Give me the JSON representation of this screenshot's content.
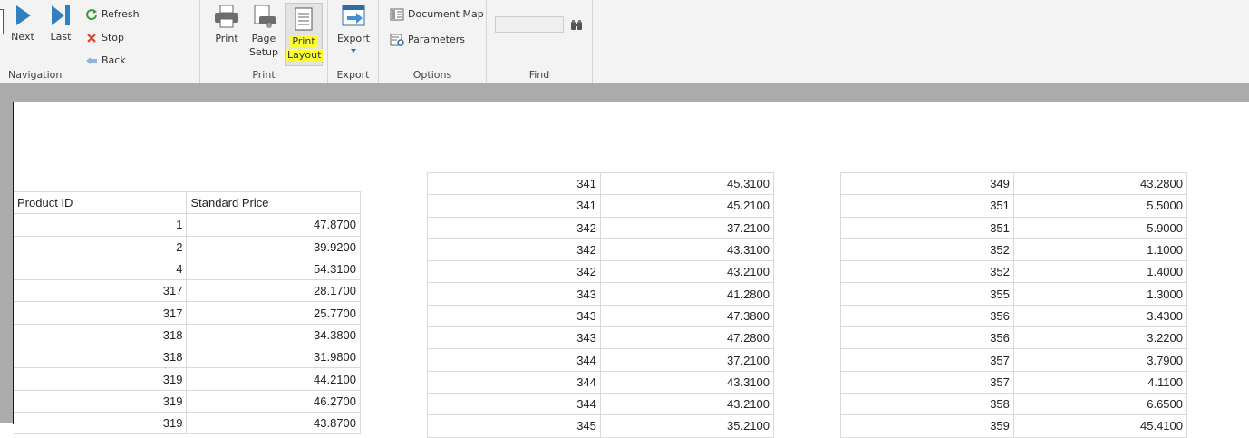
{
  "ribbon": {
    "navigation": {
      "next_label": "Next",
      "last_label": "Last",
      "refresh_label": "Refresh",
      "stop_label": "Stop",
      "back_label": "Back",
      "group_label": "Navigation"
    },
    "print": {
      "print_label": "Print",
      "page_setup_line1": "Page",
      "page_setup_line2": "Setup",
      "print_layout_line1": "Print",
      "print_layout_line2": "Layout",
      "group_label": "Print"
    },
    "export": {
      "export_label": "Export",
      "group_label": "Export"
    },
    "options": {
      "document_map_label": "Document Map",
      "parameters_label": "Parameters",
      "group_label": "Options"
    },
    "find": {
      "group_label": "Find",
      "search_value": ""
    }
  },
  "report": {
    "headers": [
      "Product ID",
      "Standard Price"
    ],
    "column1": [
      [
        "1",
        "47.8700"
      ],
      [
        "2",
        "39.9200"
      ],
      [
        "4",
        "54.3100"
      ],
      [
        "317",
        "28.1700"
      ],
      [
        "317",
        "25.7700"
      ],
      [
        "318",
        "34.3800"
      ],
      [
        "318",
        "31.9800"
      ],
      [
        "319",
        "44.2100"
      ],
      [
        "319",
        "46.2700"
      ],
      [
        "319",
        "43.8700"
      ]
    ],
    "column2": [
      [
        "341",
        "45.3100"
      ],
      [
        "341",
        "45.2100"
      ],
      [
        "342",
        "37.2100"
      ],
      [
        "342",
        "43.3100"
      ],
      [
        "342",
        "43.2100"
      ],
      [
        "343",
        "41.2800"
      ],
      [
        "343",
        "47.3800"
      ],
      [
        "343",
        "47.2800"
      ],
      [
        "344",
        "37.2100"
      ],
      [
        "344",
        "43.3100"
      ],
      [
        "344",
        "43.2100"
      ],
      [
        "345",
        "35.2100"
      ]
    ],
    "column3": [
      [
        "349",
        "43.2800"
      ],
      [
        "351",
        "5.5000"
      ],
      [
        "351",
        "5.9000"
      ],
      [
        "352",
        "1.1000"
      ],
      [
        "352",
        "1.4000"
      ],
      [
        "355",
        "1.3000"
      ],
      [
        "356",
        "3.4300"
      ],
      [
        "356",
        "3.2200"
      ],
      [
        "357",
        "3.7900"
      ],
      [
        "357",
        "4.1100"
      ],
      [
        "358",
        "6.6500"
      ],
      [
        "359",
        "45.4100"
      ]
    ]
  }
}
